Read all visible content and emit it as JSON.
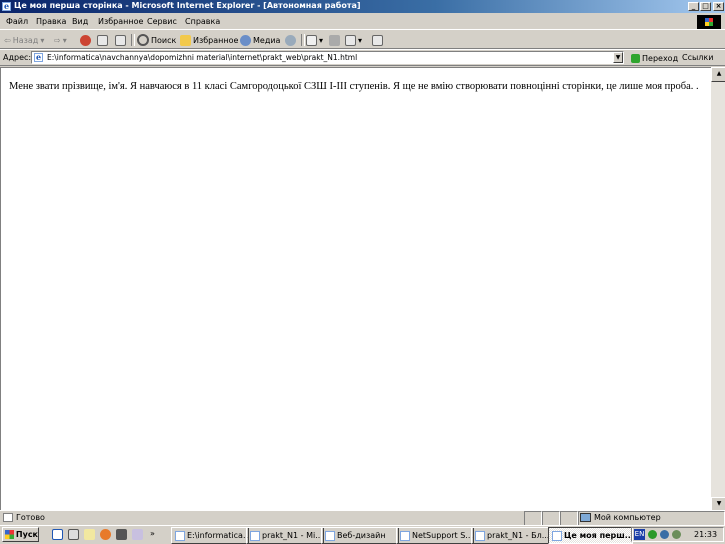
{
  "window": {
    "title": "Це моя перша сторінка - Microsoft Internet Explorer - [Автономная работа]",
    "controls": {
      "minimize": "_",
      "maximize": "□",
      "close": "×"
    }
  },
  "menu": [
    "Файл",
    "Правка",
    "Вид",
    "Избранное",
    "Сервис",
    "Справка"
  ],
  "toolbar": {
    "back": "Назад",
    "search": "Поиск",
    "favorites": "Избранное",
    "media": "Медиа"
  },
  "address": {
    "label": "Адрес:",
    "value": "E:\\informatica\\navchannya\\dopomizhni material\\internet\\prakt_web\\prakt_N1.html",
    "go": "Переход",
    "links": "Ссылки"
  },
  "page": {
    "text": "Мене звати прізвище, ім'я. Я навчаюся в 11 класі Самгородоцької СЗШ І-ІІІ ступенів. Я ще не вмію створювати повноцінні сторінки, це лише моя проба. ."
  },
  "status": {
    "text": "Готово",
    "zone": "Мой компьютер"
  },
  "taskbar": {
    "start": "Пуск",
    "tasks": [
      "E:\\informatica...",
      "prakt_N1 - Mi...",
      "Веб-дизайн",
      "NetSupport S...",
      "prakt_N1 - Бл...",
      "Це моя перш..."
    ],
    "lang": "EN",
    "clock": "21:33"
  },
  "colors": {
    "titlebar_start": "#0a246a",
    "titlebar_end": "#a6caf0",
    "chrome": "#d4d0c8"
  }
}
